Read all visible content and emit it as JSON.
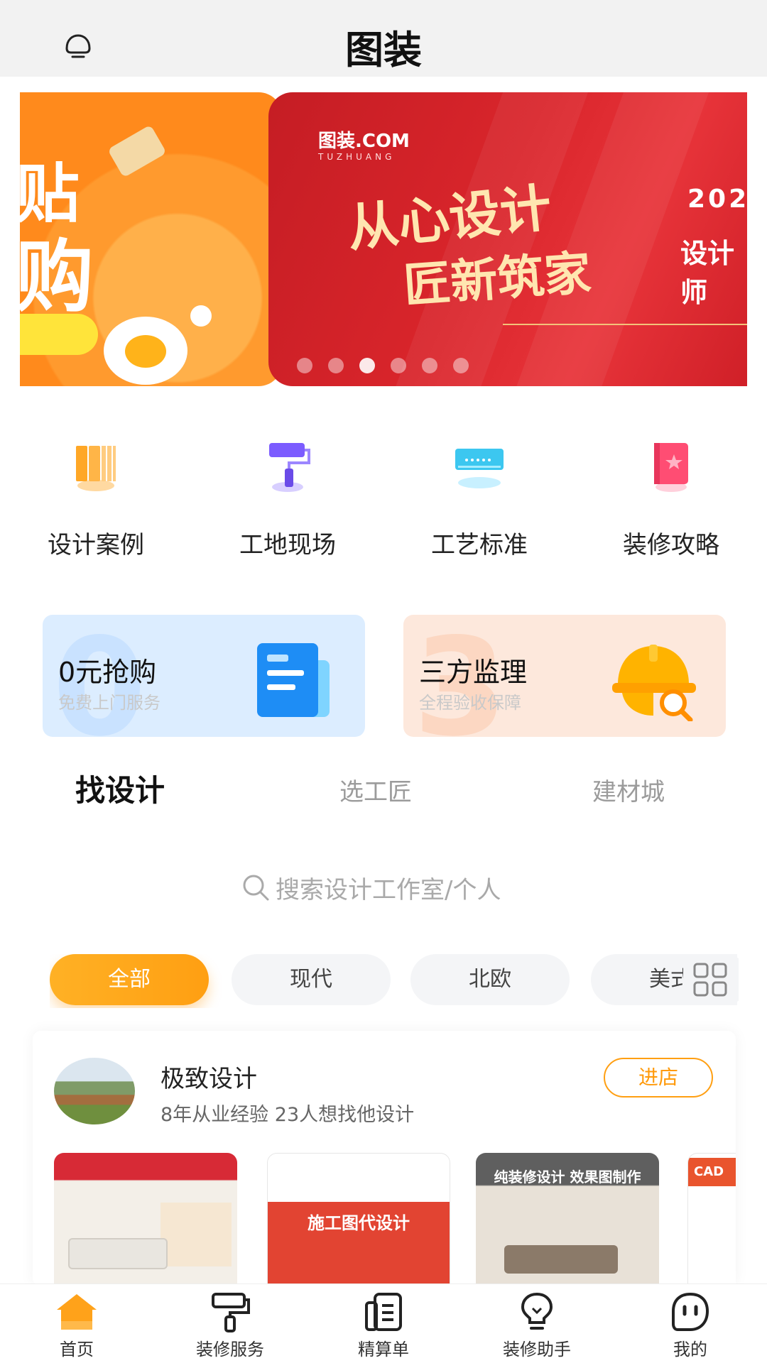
{
  "header": {
    "title": "图装"
  },
  "banner": {
    "slide_left": {
      "line1": "贴",
      "line2": "购"
    },
    "slide_right": {
      "logo": "图装.COM",
      "logo_sub": "TUZHUANG",
      "headline1": "从心设计",
      "headline2": "匠新筑家",
      "year": "202",
      "sub": "设计师"
    },
    "dots_count": 6,
    "active_dot": 2
  },
  "quick_links": [
    {
      "label": "设计案例",
      "icon": "book-stack-icon",
      "color": "#ffa726"
    },
    {
      "label": "工地现场",
      "icon": "paint-roller-icon",
      "color": "#7c5cff"
    },
    {
      "label": "工艺标准",
      "icon": "air-conditioner-icon",
      "color": "#3cc7f0"
    },
    {
      "label": "装修攻略",
      "icon": "guide-book-icon",
      "color": "#ff4d73"
    }
  ],
  "promos": [
    {
      "title": "0元抢购",
      "subtitle": "免费上门服务",
      "bg_number": "0",
      "icon": "document-icon"
    },
    {
      "title": "三方监理",
      "subtitle": "全程验收保障",
      "bg_number": "3",
      "icon": "helmet-icon"
    }
  ],
  "tabs": [
    {
      "label": "找设计",
      "active": true
    },
    {
      "label": "选工匠",
      "active": false
    },
    {
      "label": "建材城",
      "active": false
    }
  ],
  "search": {
    "placeholder": "搜索设计工作室/个人"
  },
  "filters": [
    {
      "label": "全部",
      "active": true
    },
    {
      "label": "现代",
      "active": false
    },
    {
      "label": "北欧",
      "active": false
    },
    {
      "label": "美式",
      "active": false
    }
  ],
  "designer": {
    "name": "极致设计",
    "info": "8年从业经验 23人想找他设计",
    "enter_label": "进店",
    "thumbs": [
      {
        "caption": ""
      },
      {
        "caption": "施工图代设计"
      },
      {
        "caption": "纯装修设计 效果图制作"
      },
      {
        "caption": "CAD"
      }
    ]
  },
  "bottom_nav": [
    {
      "label": "首页",
      "icon": "home-icon",
      "active": true
    },
    {
      "label": "装修服务",
      "icon": "paint-roller-icon",
      "active": false
    },
    {
      "label": "精算单",
      "icon": "bill-icon",
      "active": false
    },
    {
      "label": "装修助手",
      "icon": "lightbulb-icon",
      "active": false
    },
    {
      "label": "我的",
      "icon": "profile-face-icon",
      "active": false
    }
  ],
  "colors": {
    "accent": "#ffa21a",
    "header_bg": "#f2f2f2"
  }
}
